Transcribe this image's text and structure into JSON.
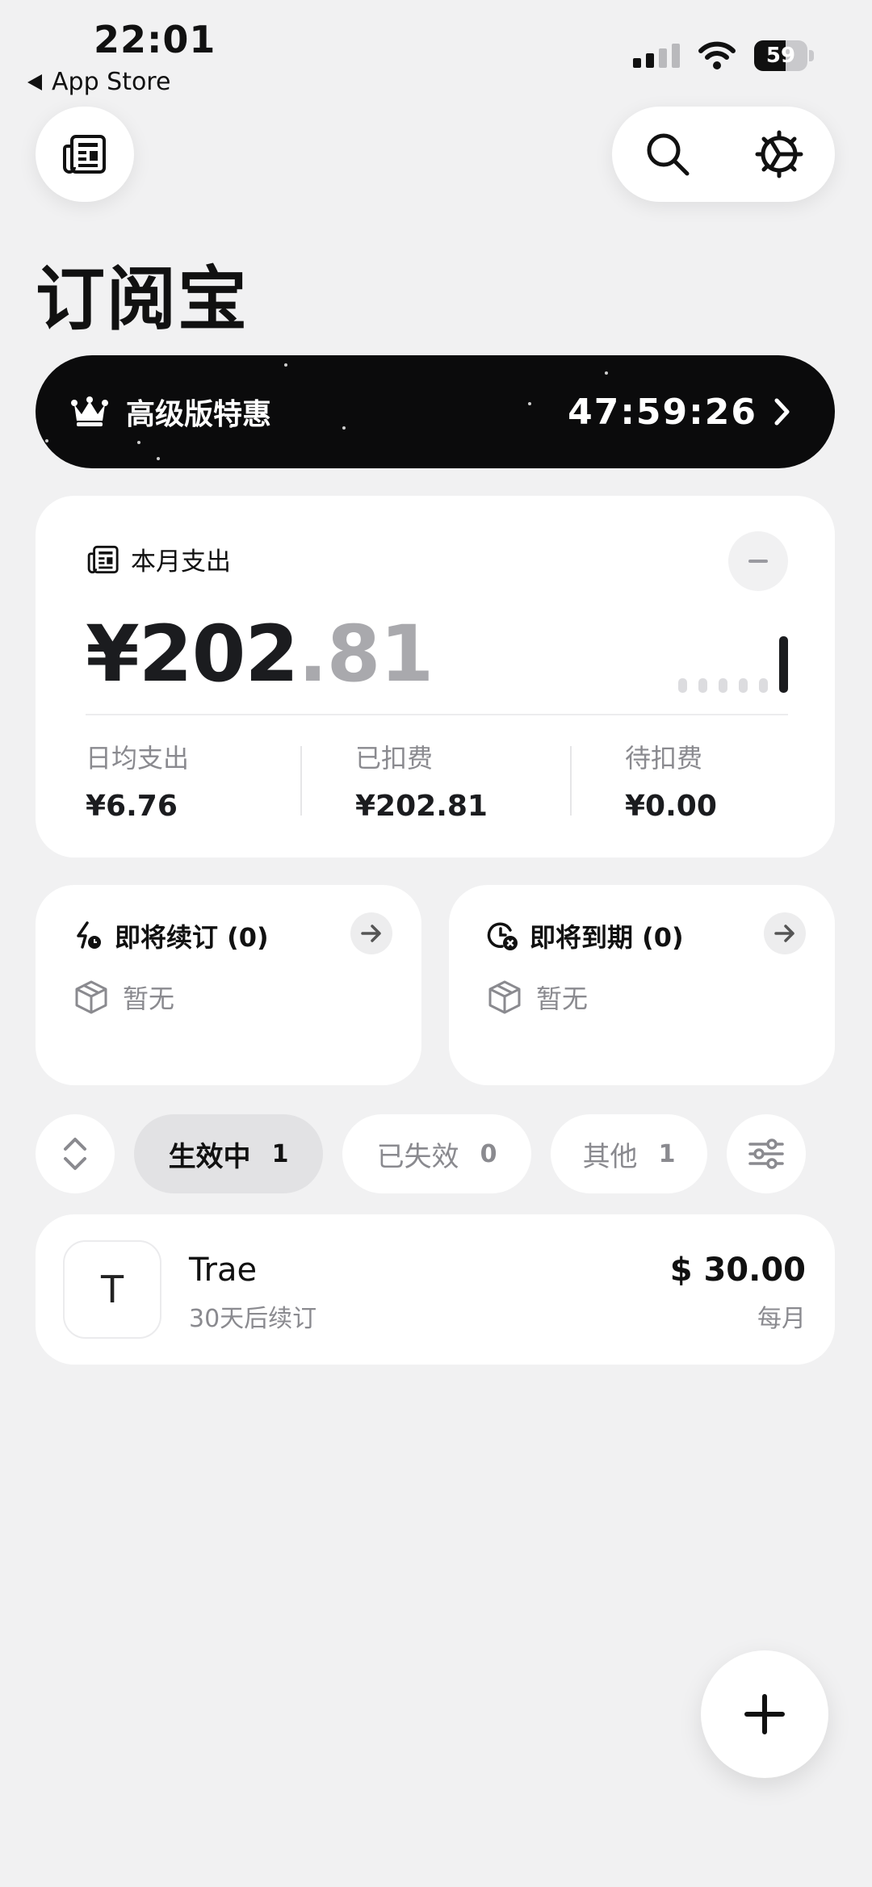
{
  "status_bar": {
    "time": "22:01",
    "back_label": "App Store",
    "battery": "59",
    "battery_level": 0.59
  },
  "app": {
    "title": "订阅宝"
  },
  "promo": {
    "label": "高级版特惠",
    "timer": "47:59:26"
  },
  "expense": {
    "title": "本月支出",
    "amount_int": "¥202",
    "amount_dec": ".81",
    "stats": [
      {
        "label": "日均支出",
        "value": "¥6.76"
      },
      {
        "label": "已扣费",
        "value": "¥202.81"
      },
      {
        "label": "待扣费",
        "value": "¥0.00"
      }
    ]
  },
  "upcoming": [
    {
      "title": "即将续订 (0)",
      "empty": "暂无"
    },
    {
      "title": "即将到期 (0)",
      "empty": "暂无"
    }
  ],
  "filters": [
    {
      "label": "生效中",
      "count": "1",
      "active": true
    },
    {
      "label": "已失效",
      "count": "0",
      "active": false
    },
    {
      "label": "其他",
      "count": "1",
      "active": false
    }
  ],
  "subscriptions": [
    {
      "logo": "T",
      "name": "Trae",
      "renew": "30天后续订",
      "price": "$ 30.00",
      "cycle": "每月"
    }
  ],
  "icons": {
    "news": "newspaper-icon",
    "search": "search-icon",
    "settings": "gear-icon",
    "crown": "crown-icon",
    "sort": "sort-icon",
    "filter": "sliders-icon",
    "add": "plus-icon"
  }
}
